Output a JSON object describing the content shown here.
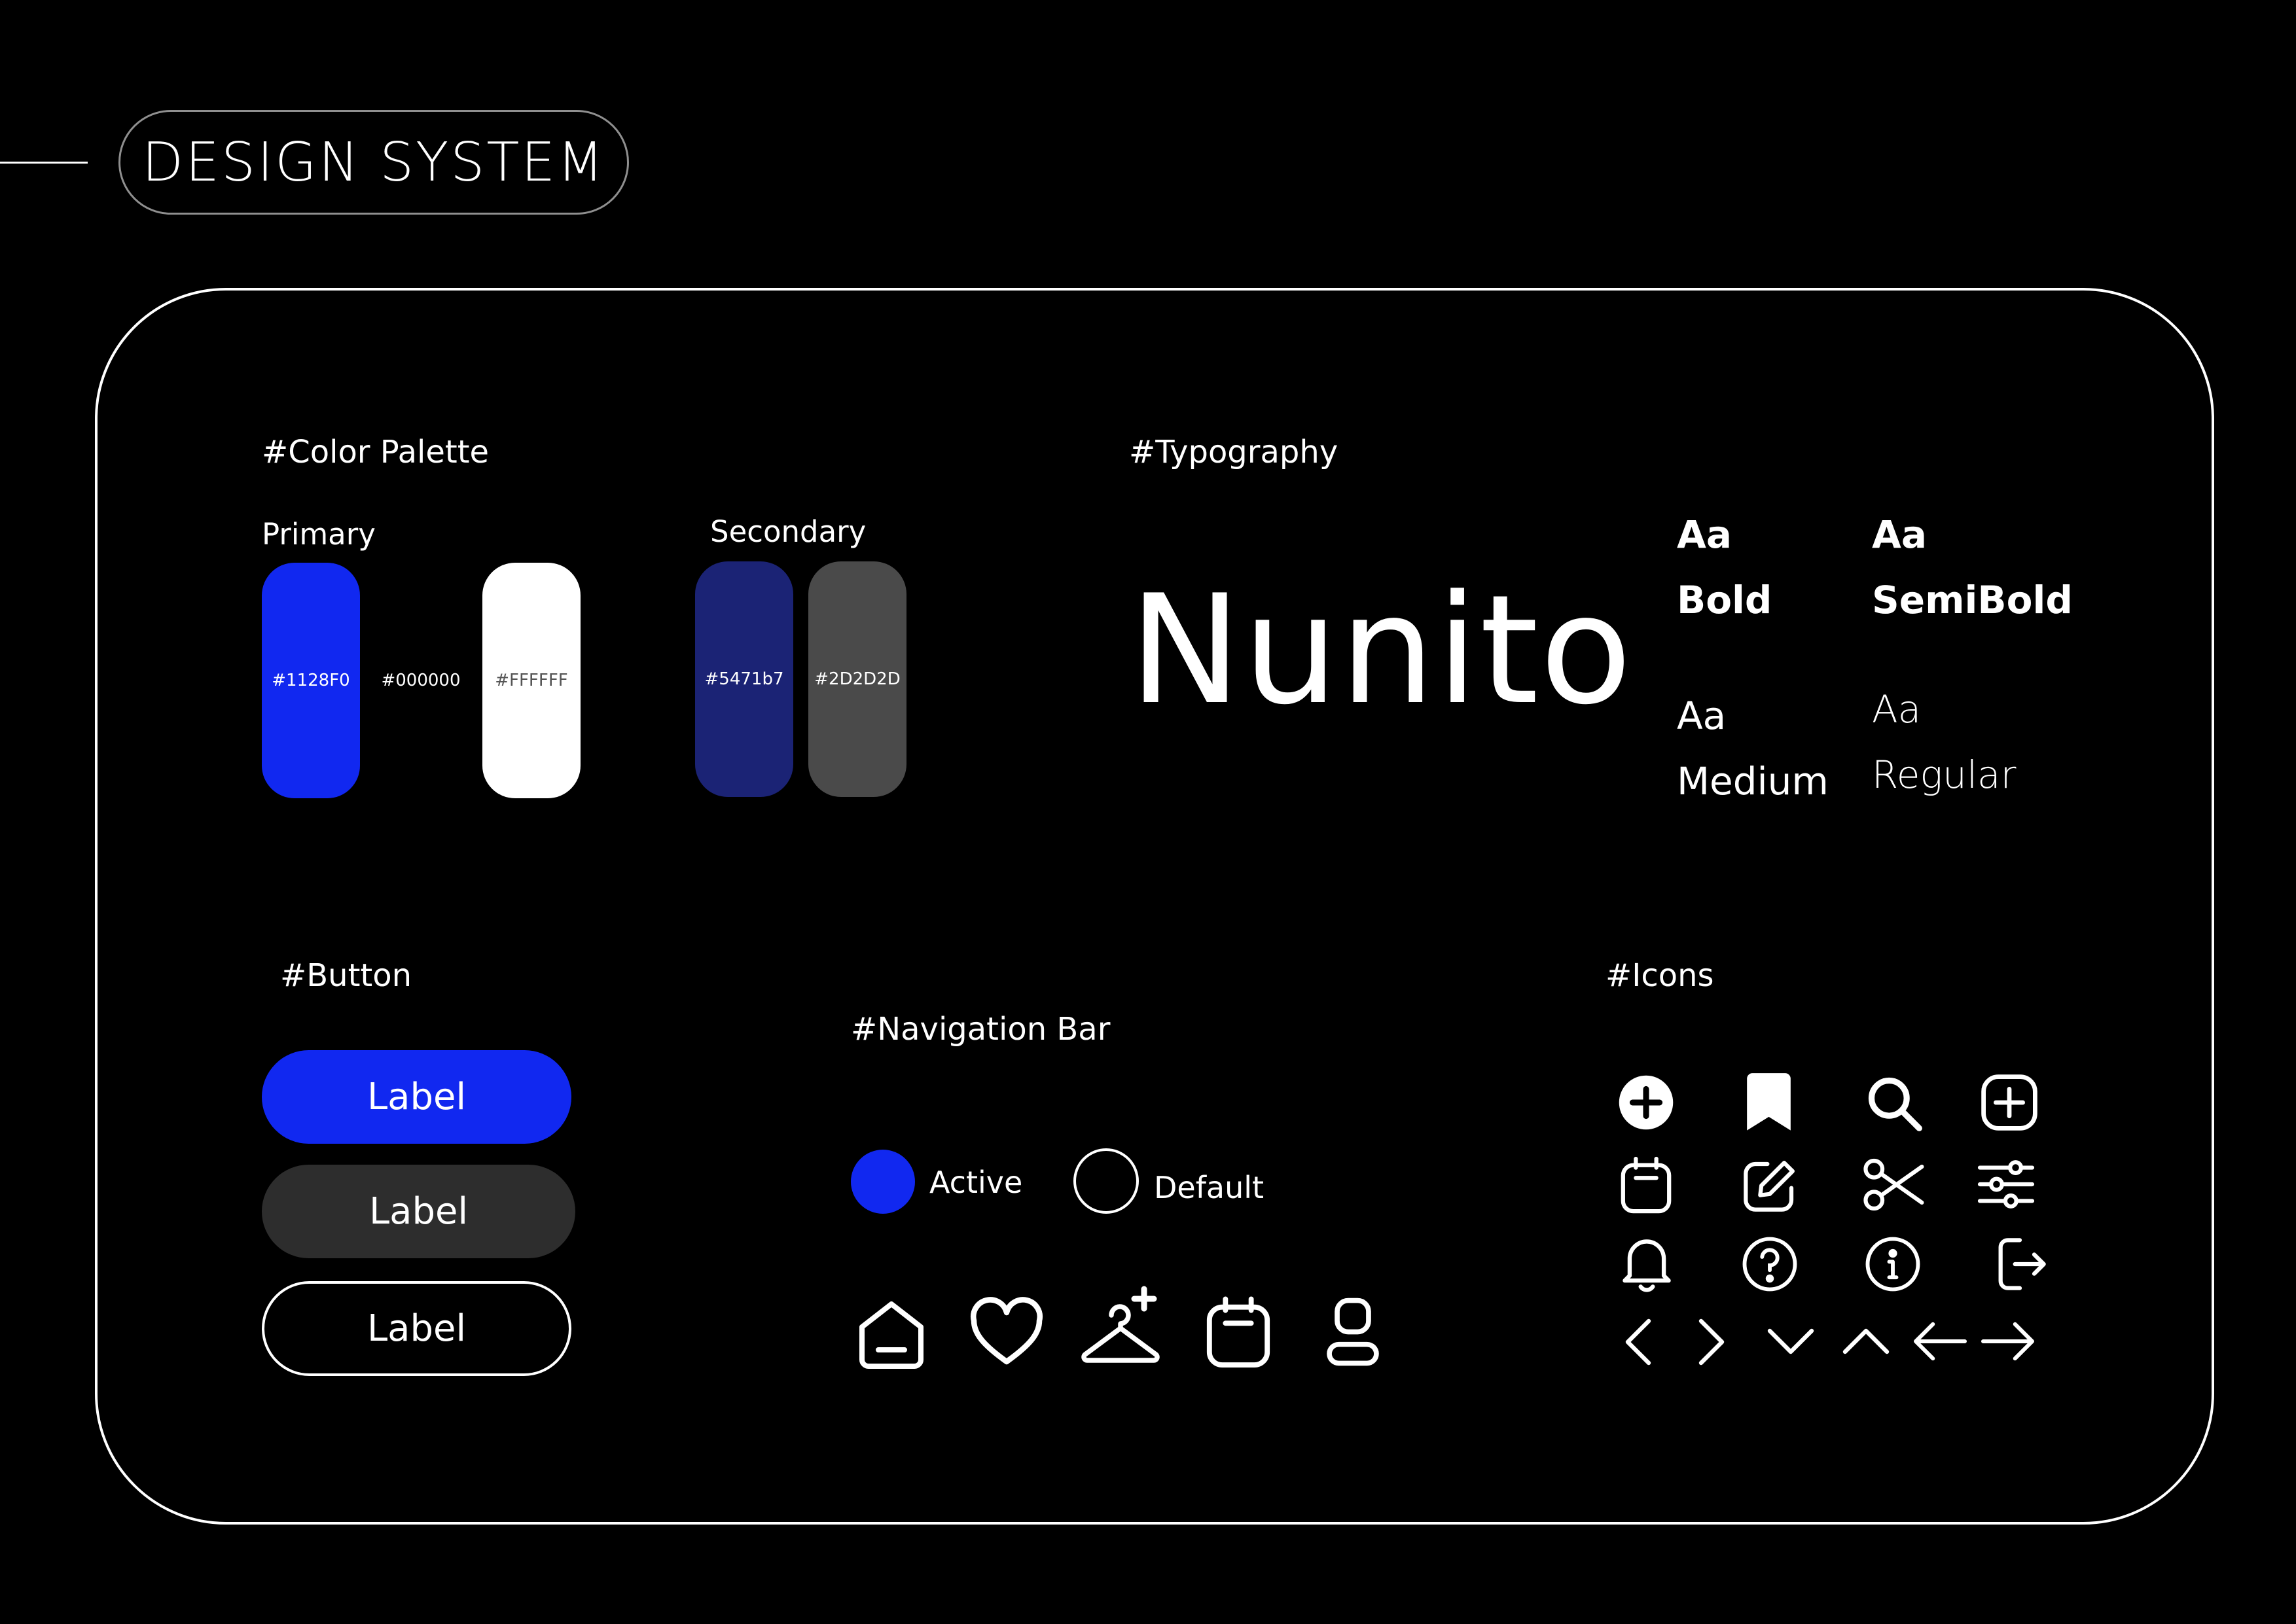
{
  "header": {
    "title": "DESIGN SYSTEM"
  },
  "color_palette": {
    "title": "#Color Palette",
    "primary_label": "Primary",
    "secondary_label": "Secondary",
    "primary": [
      {
        "label": "#1128F0",
        "color": "#1128F0",
        "text_color": "#ffffff"
      },
      {
        "label": "#000000",
        "color": "#000000",
        "text_color": "#ffffff"
      },
      {
        "label": "#FFFFFF",
        "color": "#FFFFFF",
        "text_color": "#555555"
      }
    ],
    "secondary": [
      {
        "label": "#5471b7",
        "color": "#1B2375",
        "text_color": "#ffffff"
      },
      {
        "label": "#2D2D2D",
        "color": "#4A4A4A",
        "text_color": "#ffffff"
      }
    ]
  },
  "typography": {
    "title": "#Typography",
    "font_name": "Nunito",
    "weights": [
      {
        "sample": "Aa",
        "name": "Bold"
      },
      {
        "sample": "Aa",
        "name": "SemiBold"
      },
      {
        "sample": "Aa",
        "name": "Medium"
      },
      {
        "sample": "Aa",
        "name": "Regular"
      }
    ]
  },
  "button": {
    "title": "#Button",
    "primary_label": "Label",
    "secondary_label": "Label",
    "outline_label": "Label",
    "primary_color": "#1128F0",
    "secondary_color": "#2D2D2D"
  },
  "navigation_bar": {
    "title": "#Navigation Bar",
    "active_label": "Active",
    "default_label": "Default",
    "active_color": "#1128F0",
    "icons": [
      "home-icon",
      "heart-icon",
      "hanger-sparkle-icon",
      "calendar-icon",
      "profile-icon"
    ]
  },
  "icons": {
    "title": "#Icons",
    "rows": [
      [
        "plus-circle-filled-icon",
        "bookmark-icon",
        "search-icon",
        "plus-square-icon"
      ],
      [
        "calendar-icon",
        "edit-icon",
        "scissors-icon",
        "sliders-icon"
      ],
      [
        "bell-icon",
        "help-circle-icon",
        "info-circle-icon",
        "logout-icon"
      ],
      [
        "chevron-left-icon",
        "chevron-right-icon",
        "chevron-down-icon",
        "chevron-up-icon",
        "arrow-left-icon",
        "arrow-right-icon"
      ]
    ]
  }
}
